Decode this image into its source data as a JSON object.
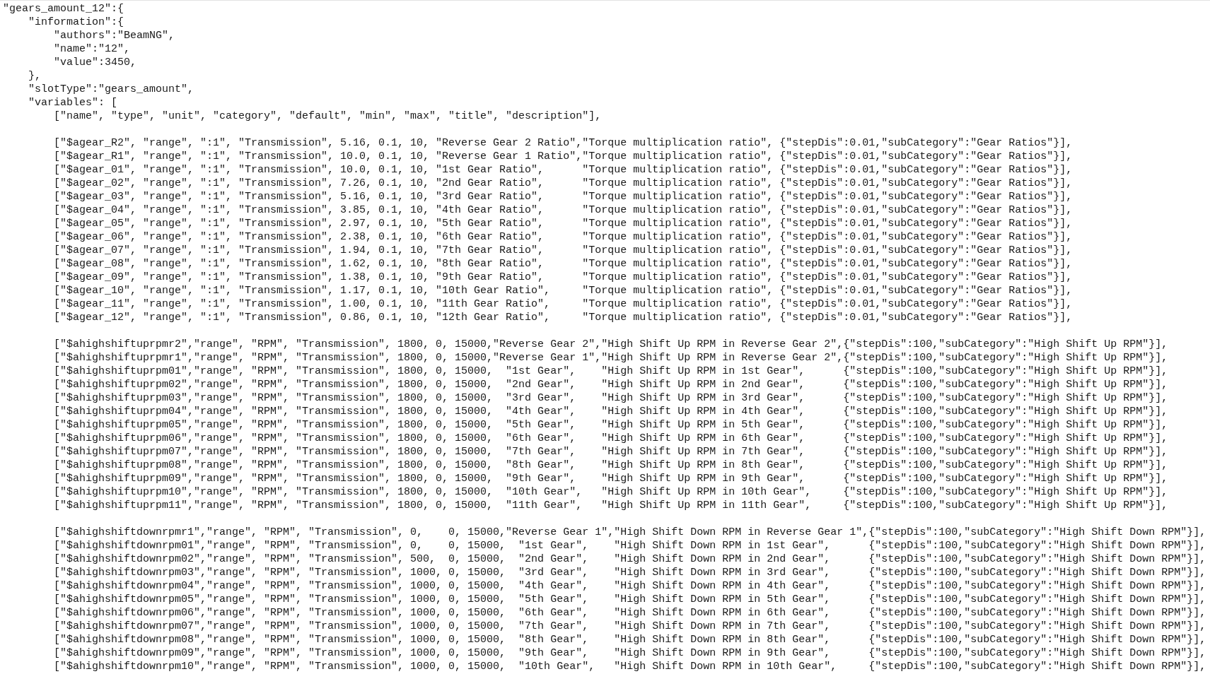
{
  "code_view": {
    "blocks": [
      [
        "\"gears_amount_12\":{",
        "    \"information\":{",
        "        \"authors\":\"BeamNG\",",
        "        \"name\":\"12\",",
        "        \"value\":3450,",
        "    },",
        "    \"slotType\":\"gears_amount\",",
        "    \"variables\": [",
        "        [\"name\", \"type\", \"unit\", \"category\", \"default\", \"min\", \"max\", \"title\", \"description\"],"
      ],
      [
        "        [\"$agear_R2\", \"range\", \":1\", \"Transmission\", 5.16, 0.1, 10, \"Reverse Gear 2 Ratio\",\"Torque multiplication ratio\", {\"stepDis\":0.01,\"subCategory\":\"Gear Ratios\"}],",
        "        [\"$agear_R1\", \"range\", \":1\", \"Transmission\", 10.0, 0.1, 10, \"Reverse Gear 1 Ratio\",\"Torque multiplication ratio\", {\"stepDis\":0.01,\"subCategory\":\"Gear Ratios\"}],",
        "        [\"$agear_01\", \"range\", \":1\", \"Transmission\", 10.0, 0.1, 10, \"1st Gear Ratio\",      \"Torque multiplication ratio\", {\"stepDis\":0.01,\"subCategory\":\"Gear Ratios\"}],",
        "        [\"$agear_02\", \"range\", \":1\", \"Transmission\", 7.26, 0.1, 10, \"2nd Gear Ratio\",      \"Torque multiplication ratio\", {\"stepDis\":0.01,\"subCategory\":\"Gear Ratios\"}],",
        "        [\"$agear_03\", \"range\", \":1\", \"Transmission\", 5.16, 0.1, 10, \"3rd Gear Ratio\",      \"Torque multiplication ratio\", {\"stepDis\":0.01,\"subCategory\":\"Gear Ratios\"}],",
        "        [\"$agear_04\", \"range\", \":1\", \"Transmission\", 3.85, 0.1, 10, \"4th Gear Ratio\",      \"Torque multiplication ratio\", {\"stepDis\":0.01,\"subCategory\":\"Gear Ratios\"}],",
        "        [\"$agear_05\", \"range\", \":1\", \"Transmission\", 2.97, 0.1, 10, \"5th Gear Ratio\",      \"Torque multiplication ratio\", {\"stepDis\":0.01,\"subCategory\":\"Gear Ratios\"}],",
        "        [\"$agear_06\", \"range\", \":1\", \"Transmission\", 2.38, 0.1, 10, \"6th Gear Ratio\",      \"Torque multiplication ratio\", {\"stepDis\":0.01,\"subCategory\":\"Gear Ratios\"}],",
        "        [\"$agear_07\", \"range\", \":1\", \"Transmission\", 1.94, 0.1, 10, \"7th Gear Ratio\",      \"Torque multiplication ratio\", {\"stepDis\":0.01,\"subCategory\":\"Gear Ratios\"}],",
        "        [\"$agear_08\", \"range\", \":1\", \"Transmission\", 1.62, 0.1, 10, \"8th Gear Ratio\",      \"Torque multiplication ratio\", {\"stepDis\":0.01,\"subCategory\":\"Gear Ratios\"}],",
        "        [\"$agear_09\", \"range\", \":1\", \"Transmission\", 1.38, 0.1, 10, \"9th Gear Ratio\",      \"Torque multiplication ratio\", {\"stepDis\":0.01,\"subCategory\":\"Gear Ratios\"}],",
        "        [\"$agear_10\", \"range\", \":1\", \"Transmission\", 1.17, 0.1, 10, \"10th Gear Ratio\",     \"Torque multiplication ratio\", {\"stepDis\":0.01,\"subCategory\":\"Gear Ratios\"}],",
        "        [\"$agear_11\", \"range\", \":1\", \"Transmission\", 1.00, 0.1, 10, \"11th Gear Ratio\",     \"Torque multiplication ratio\", {\"stepDis\":0.01,\"subCategory\":\"Gear Ratios\"}],",
        "        [\"$agear_12\", \"range\", \":1\", \"Transmission\", 0.86, 0.1, 10, \"12th Gear Ratio\",     \"Torque multiplication ratio\", {\"stepDis\":0.01,\"subCategory\":\"Gear Ratios\"}],"
      ],
      [
        "        [\"$ahighshiftuprpmr2\",\"range\", \"RPM\", \"Transmission\", 1800, 0, 15000,\"Reverse Gear 2\",\"High Shift Up RPM in Reverse Gear 2\",{\"stepDis\":100,\"subCategory\":\"High Shift Up RPM\"}],",
        "        [\"$ahighshiftuprpmr1\",\"range\", \"RPM\", \"Transmission\", 1800, 0, 15000,\"Reverse Gear 1\",\"High Shift Up RPM in Reverse Gear 2\",{\"stepDis\":100,\"subCategory\":\"High Shift Up RPM\"}],",
        "        [\"$ahighshiftuprpm01\",\"range\", \"RPM\", \"Transmission\", 1800, 0, 15000,  \"1st Gear\",    \"High Shift Up RPM in 1st Gear\",      {\"stepDis\":100,\"subCategory\":\"High Shift Up RPM\"}],",
        "        [\"$ahighshiftuprpm02\",\"range\", \"RPM\", \"Transmission\", 1800, 0, 15000,  \"2nd Gear\",    \"High Shift Up RPM in 2nd Gear\",      {\"stepDis\":100,\"subCategory\":\"High Shift Up RPM\"}],",
        "        [\"$ahighshiftuprpm03\",\"range\", \"RPM\", \"Transmission\", 1800, 0, 15000,  \"3rd Gear\",    \"High Shift Up RPM in 3rd Gear\",      {\"stepDis\":100,\"subCategory\":\"High Shift Up RPM\"}],",
        "        [\"$ahighshiftuprpm04\",\"range\", \"RPM\", \"Transmission\", 1800, 0, 15000,  \"4th Gear\",    \"High Shift Up RPM in 4th Gear\",      {\"stepDis\":100,\"subCategory\":\"High Shift Up RPM\"}],",
        "        [\"$ahighshiftuprpm05\",\"range\", \"RPM\", \"Transmission\", 1800, 0, 15000,  \"5th Gear\",    \"High Shift Up RPM in 5th Gear\",      {\"stepDis\":100,\"subCategory\":\"High Shift Up RPM\"}],",
        "        [\"$ahighshiftuprpm06\",\"range\", \"RPM\", \"Transmission\", 1800, 0, 15000,  \"6th Gear\",    \"High Shift Up RPM in 6th Gear\",      {\"stepDis\":100,\"subCategory\":\"High Shift Up RPM\"}],",
        "        [\"$ahighshiftuprpm07\",\"range\", \"RPM\", \"Transmission\", 1800, 0, 15000,  \"7th Gear\",    \"High Shift Up RPM in 7th Gear\",      {\"stepDis\":100,\"subCategory\":\"High Shift Up RPM\"}],",
        "        [\"$ahighshiftuprpm08\",\"range\", \"RPM\", \"Transmission\", 1800, 0, 15000,  \"8th Gear\",    \"High Shift Up RPM in 8th Gear\",      {\"stepDis\":100,\"subCategory\":\"High Shift Up RPM\"}],",
        "        [\"$ahighshiftuprpm09\",\"range\", \"RPM\", \"Transmission\", 1800, 0, 15000,  \"9th Gear\",    \"High Shift Up RPM in 9th Gear\",      {\"stepDis\":100,\"subCategory\":\"High Shift Up RPM\"}],",
        "        [\"$ahighshiftuprpm10\",\"range\", \"RPM\", \"Transmission\", 1800, 0, 15000,  \"10th Gear\",   \"High Shift Up RPM in 10th Gear\",     {\"stepDis\":100,\"subCategory\":\"High Shift Up RPM\"}],",
        "        [\"$ahighshiftuprpm11\",\"range\", \"RPM\", \"Transmission\", 1800, 0, 15000,  \"11th Gear\",   \"High Shift Up RPM in 11th Gear\",     {\"stepDis\":100,\"subCategory\":\"High Shift Up RPM\"}],"
      ],
      [
        "        [\"$ahighshiftdownrpmr1\",\"range\", \"RPM\", \"Transmission\", 0,    0, 15000,\"Reverse Gear 1\",\"High Shift Down RPM in Reverse Gear 1\",{\"stepDis\":100,\"subCategory\":\"High Shift Down RPM\"}],",
        "        [\"$ahighshiftdownrpm01\",\"range\", \"RPM\", \"Transmission\", 0,    0, 15000,  \"1st Gear\",    \"High Shift Down RPM in 1st Gear\",      {\"stepDis\":100,\"subCategory\":\"High Shift Down RPM\"}],",
        "        [\"$ahighshiftdownrpm02\",\"range\", \"RPM\", \"Transmission\", 500,  0, 15000,  \"2nd Gear\",    \"High Shift Down RPM in 2nd Gear\",      {\"stepDis\":100,\"subCategory\":\"High Shift Down RPM\"}],",
        "        [\"$ahighshiftdownrpm03\",\"range\", \"RPM\", \"Transmission\", 1000, 0, 15000,  \"3rd Gear\",    \"High Shift Down RPM in 3rd Gear\",      {\"stepDis\":100,\"subCategory\":\"High Shift Down RPM\"}],",
        "        [\"$ahighshiftdownrpm04\",\"range\", \"RPM\", \"Transmission\", 1000, 0, 15000,  \"4th Gear\",    \"High Shift Down RPM in 4th Gear\",      {\"stepDis\":100,\"subCategory\":\"High Shift Down RPM\"}],",
        "        [\"$ahighshiftdownrpm05\",\"range\", \"RPM\", \"Transmission\", 1000, 0, 15000,  \"5th Gear\",    \"High Shift Down RPM in 5th Gear\",      {\"stepDis\":100,\"subCategory\":\"High Shift Down RPM\"}],",
        "        [\"$ahighshiftdownrpm06\",\"range\", \"RPM\", \"Transmission\", 1000, 0, 15000,  \"6th Gear\",    \"High Shift Down RPM in 6th Gear\",      {\"stepDis\":100,\"subCategory\":\"High Shift Down RPM\"}],",
        "        [\"$ahighshiftdownrpm07\",\"range\", \"RPM\", \"Transmission\", 1000, 0, 15000,  \"7th Gear\",    \"High Shift Down RPM in 7th Gear\",      {\"stepDis\":100,\"subCategory\":\"High Shift Down RPM\"}],",
        "        [\"$ahighshiftdownrpm08\",\"range\", \"RPM\", \"Transmission\", 1000, 0, 15000,  \"8th Gear\",    \"High Shift Down RPM in 8th Gear\",      {\"stepDis\":100,\"subCategory\":\"High Shift Down RPM\"}],",
        "        [\"$ahighshiftdownrpm09\",\"range\", \"RPM\", \"Transmission\", 1000, 0, 15000,  \"9th Gear\",    \"High Shift Down RPM in 9th Gear\",      {\"stepDis\":100,\"subCategory\":\"High Shift Down RPM\"}],",
        "        [\"$ahighshiftdownrpm10\",\"range\", \"RPM\", \"Transmission\", 1000, 0, 15000,  \"10th Gear\",   \"High Shift Down RPM in 10th Gear\",     {\"stepDis\":100,\"subCategory\":\"High Shift Down RPM\"}],"
      ]
    ]
  }
}
